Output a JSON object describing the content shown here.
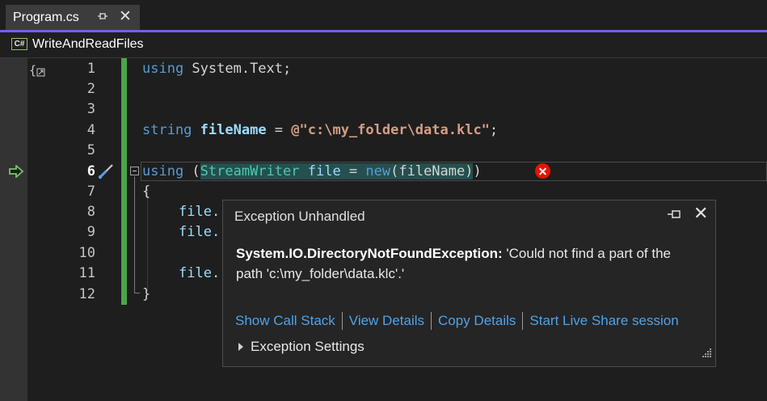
{
  "tab": {
    "title": "Program.cs"
  },
  "navbar": {
    "lang_badge": "C#",
    "project": "WriteAndReadFiles"
  },
  "editor": {
    "line_numbers": [
      "1",
      "2",
      "3",
      "4",
      "5",
      "6",
      "7",
      "8",
      "9",
      "10",
      "11",
      "12"
    ],
    "current_line": "6",
    "code": {
      "l1_kw": "using",
      "l1_rest": " System.Text;",
      "l4_kw": "string",
      "l4_var": "fileName",
      "l4_eq": " = ",
      "l4_str": "@\"c:\\my_folder\\data.klc\"",
      "l4_end": ";",
      "l6_kw": "using",
      "l6_open": " (",
      "l6_type": "StreamWriter",
      "l6_var": " file",
      "l6_eq": " = ",
      "l6_new": "new",
      "l6_arg": "(fileName)",
      "l6_close": ")",
      "l7": "{",
      "l8": "file.",
      "l9": "file.",
      "l11": "file.",
      "l12": "}"
    }
  },
  "popup": {
    "title": "Exception Unhandled",
    "exception_type": "System.IO.DirectoryNotFoundException:",
    "message": " 'Could not find a part of the path 'c:\\my_folder\\data.klc'.'",
    "links": {
      "call_stack": "Show Call Stack",
      "view_details": "View Details",
      "copy_details": "Copy Details",
      "live_share": "Start Live Share session"
    },
    "settings": "Exception Settings"
  },
  "colors": {
    "accent": "#7160e8",
    "change_bar": "#4aa64a",
    "link": "#4fa3e8",
    "error": "#e51400"
  }
}
